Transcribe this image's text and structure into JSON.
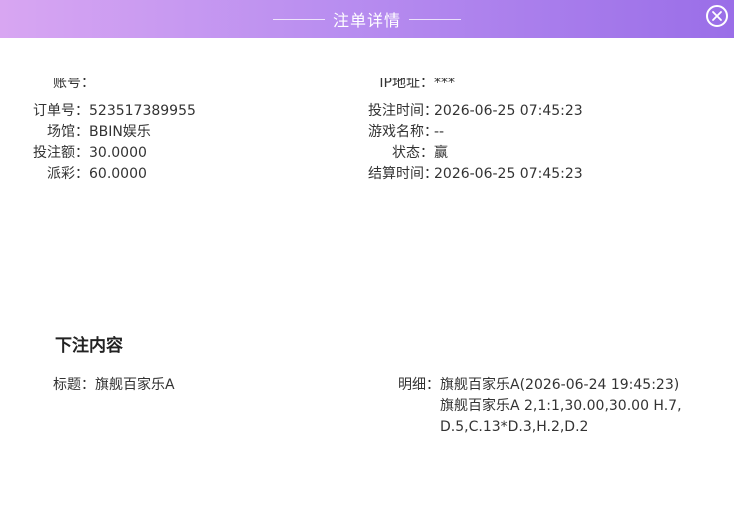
{
  "header": {
    "title": "注单详情"
  },
  "clipped_row": {
    "left_text": "账号：",
    "right_text": "IP地址：",
    "right_value": "***"
  },
  "info": {
    "left": [
      {
        "label": "订单号：",
        "value": "523517389955"
      },
      {
        "label": "场馆：",
        "value": "BBIN娱乐"
      },
      {
        "label": "投注额：",
        "value": "30.0000"
      },
      {
        "label": "派彩：",
        "value": "60.0000"
      }
    ],
    "right": [
      {
        "label": "投注时间：",
        "value": "2026-06-25 07:45:23"
      },
      {
        "label": "游戏名称：",
        "value": "--"
      },
      {
        "label": "状态：",
        "value": "赢"
      },
      {
        "label": "结算时间：",
        "value": "2026-06-25 07:45:23"
      }
    ]
  },
  "content": {
    "section_title": "下注内容",
    "title_label": "标题：",
    "title_value": "旗舰百家乐A",
    "detail_label": "明细：",
    "detail_lines": [
      "旗舰百家乐A(2026-06-24 19:45:23)",
      "旗舰百家乐A 2,1:1,30.00,30.00 H.7,",
      "D.5,C.13*D.3,H.2,D.2"
    ]
  }
}
